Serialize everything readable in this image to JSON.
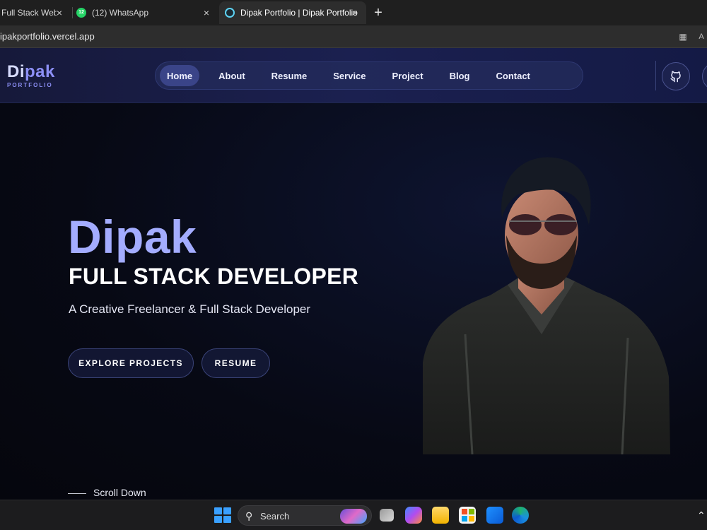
{
  "browser": {
    "tabs": [
      {
        "label": "Full Stack Web D",
        "active": false
      },
      {
        "label": "(12) WhatsApp",
        "badge": "12",
        "active": false
      },
      {
        "label": "Dipak Portfolio | Dipak Portfolio",
        "active": true
      }
    ],
    "close_glyph": "×",
    "new_tab_glyph": "+",
    "url": "ipakportfolio.vercel.app",
    "icons": [
      "tab-grid-icon",
      "read-aloud-icon"
    ]
  },
  "site": {
    "logo": {
      "main_a": "Di",
      "main_b": "pak",
      "sub": "PORTFOLIO"
    },
    "nav": [
      {
        "label": "Home",
        "active": true
      },
      {
        "label": "About"
      },
      {
        "label": "Resume"
      },
      {
        "label": "Service"
      },
      {
        "label": "Project"
      },
      {
        "label": "Blog"
      },
      {
        "label": "Contact"
      }
    ],
    "social": [
      "github-icon",
      "linkedin-icon"
    ],
    "hero": {
      "name": "Dipak",
      "role": "FULL STACK DEVELOPER",
      "tagline": "A Creative Freelancer & Full Stack Developer",
      "buttons": [
        "EXPLORE PROJECTS",
        "RESUME"
      ],
      "scroll_label": "Scroll Down"
    },
    "colors": {
      "accent": "#a3acff",
      "nav_bg": "#242c5c",
      "page_bg": "#070914"
    }
  },
  "taskbar": {
    "search_label": "Search",
    "icons": [
      "windows-start-icon",
      "search-icon",
      "task-view-icon",
      "copilot-icon",
      "file-explorer-icon",
      "microsoft-store-icon",
      "outlook-icon",
      "edge-icon",
      "tray-chevron-icon"
    ]
  }
}
